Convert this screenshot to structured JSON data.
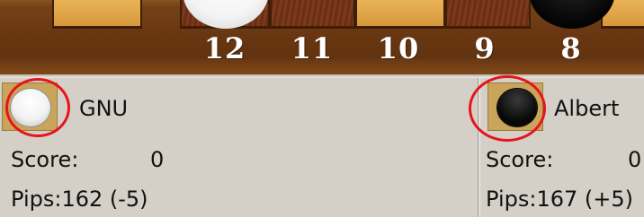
{
  "board": {
    "point_numbers": [
      "12",
      "11",
      "10",
      "9",
      "8"
    ],
    "top_checkers": [
      "white",
      "black"
    ]
  },
  "players": [
    {
      "name": "GNU",
      "checker_color": "white",
      "score_label": "Score:",
      "score_value": "0",
      "pips_text": "Pips:162 (-5)",
      "highlighted": true
    },
    {
      "name": "Albert",
      "checker_color": "black",
      "score_label": "Score:",
      "score_value": "0",
      "pips_text": "Pips:167 (+5)",
      "highlighted": true
    }
  ],
  "colors": {
    "highlight_ring": "#e8141c",
    "panel_bg": "#d4d0c8",
    "light_point": "#e0a64a",
    "dark_point": "#72321a"
  }
}
